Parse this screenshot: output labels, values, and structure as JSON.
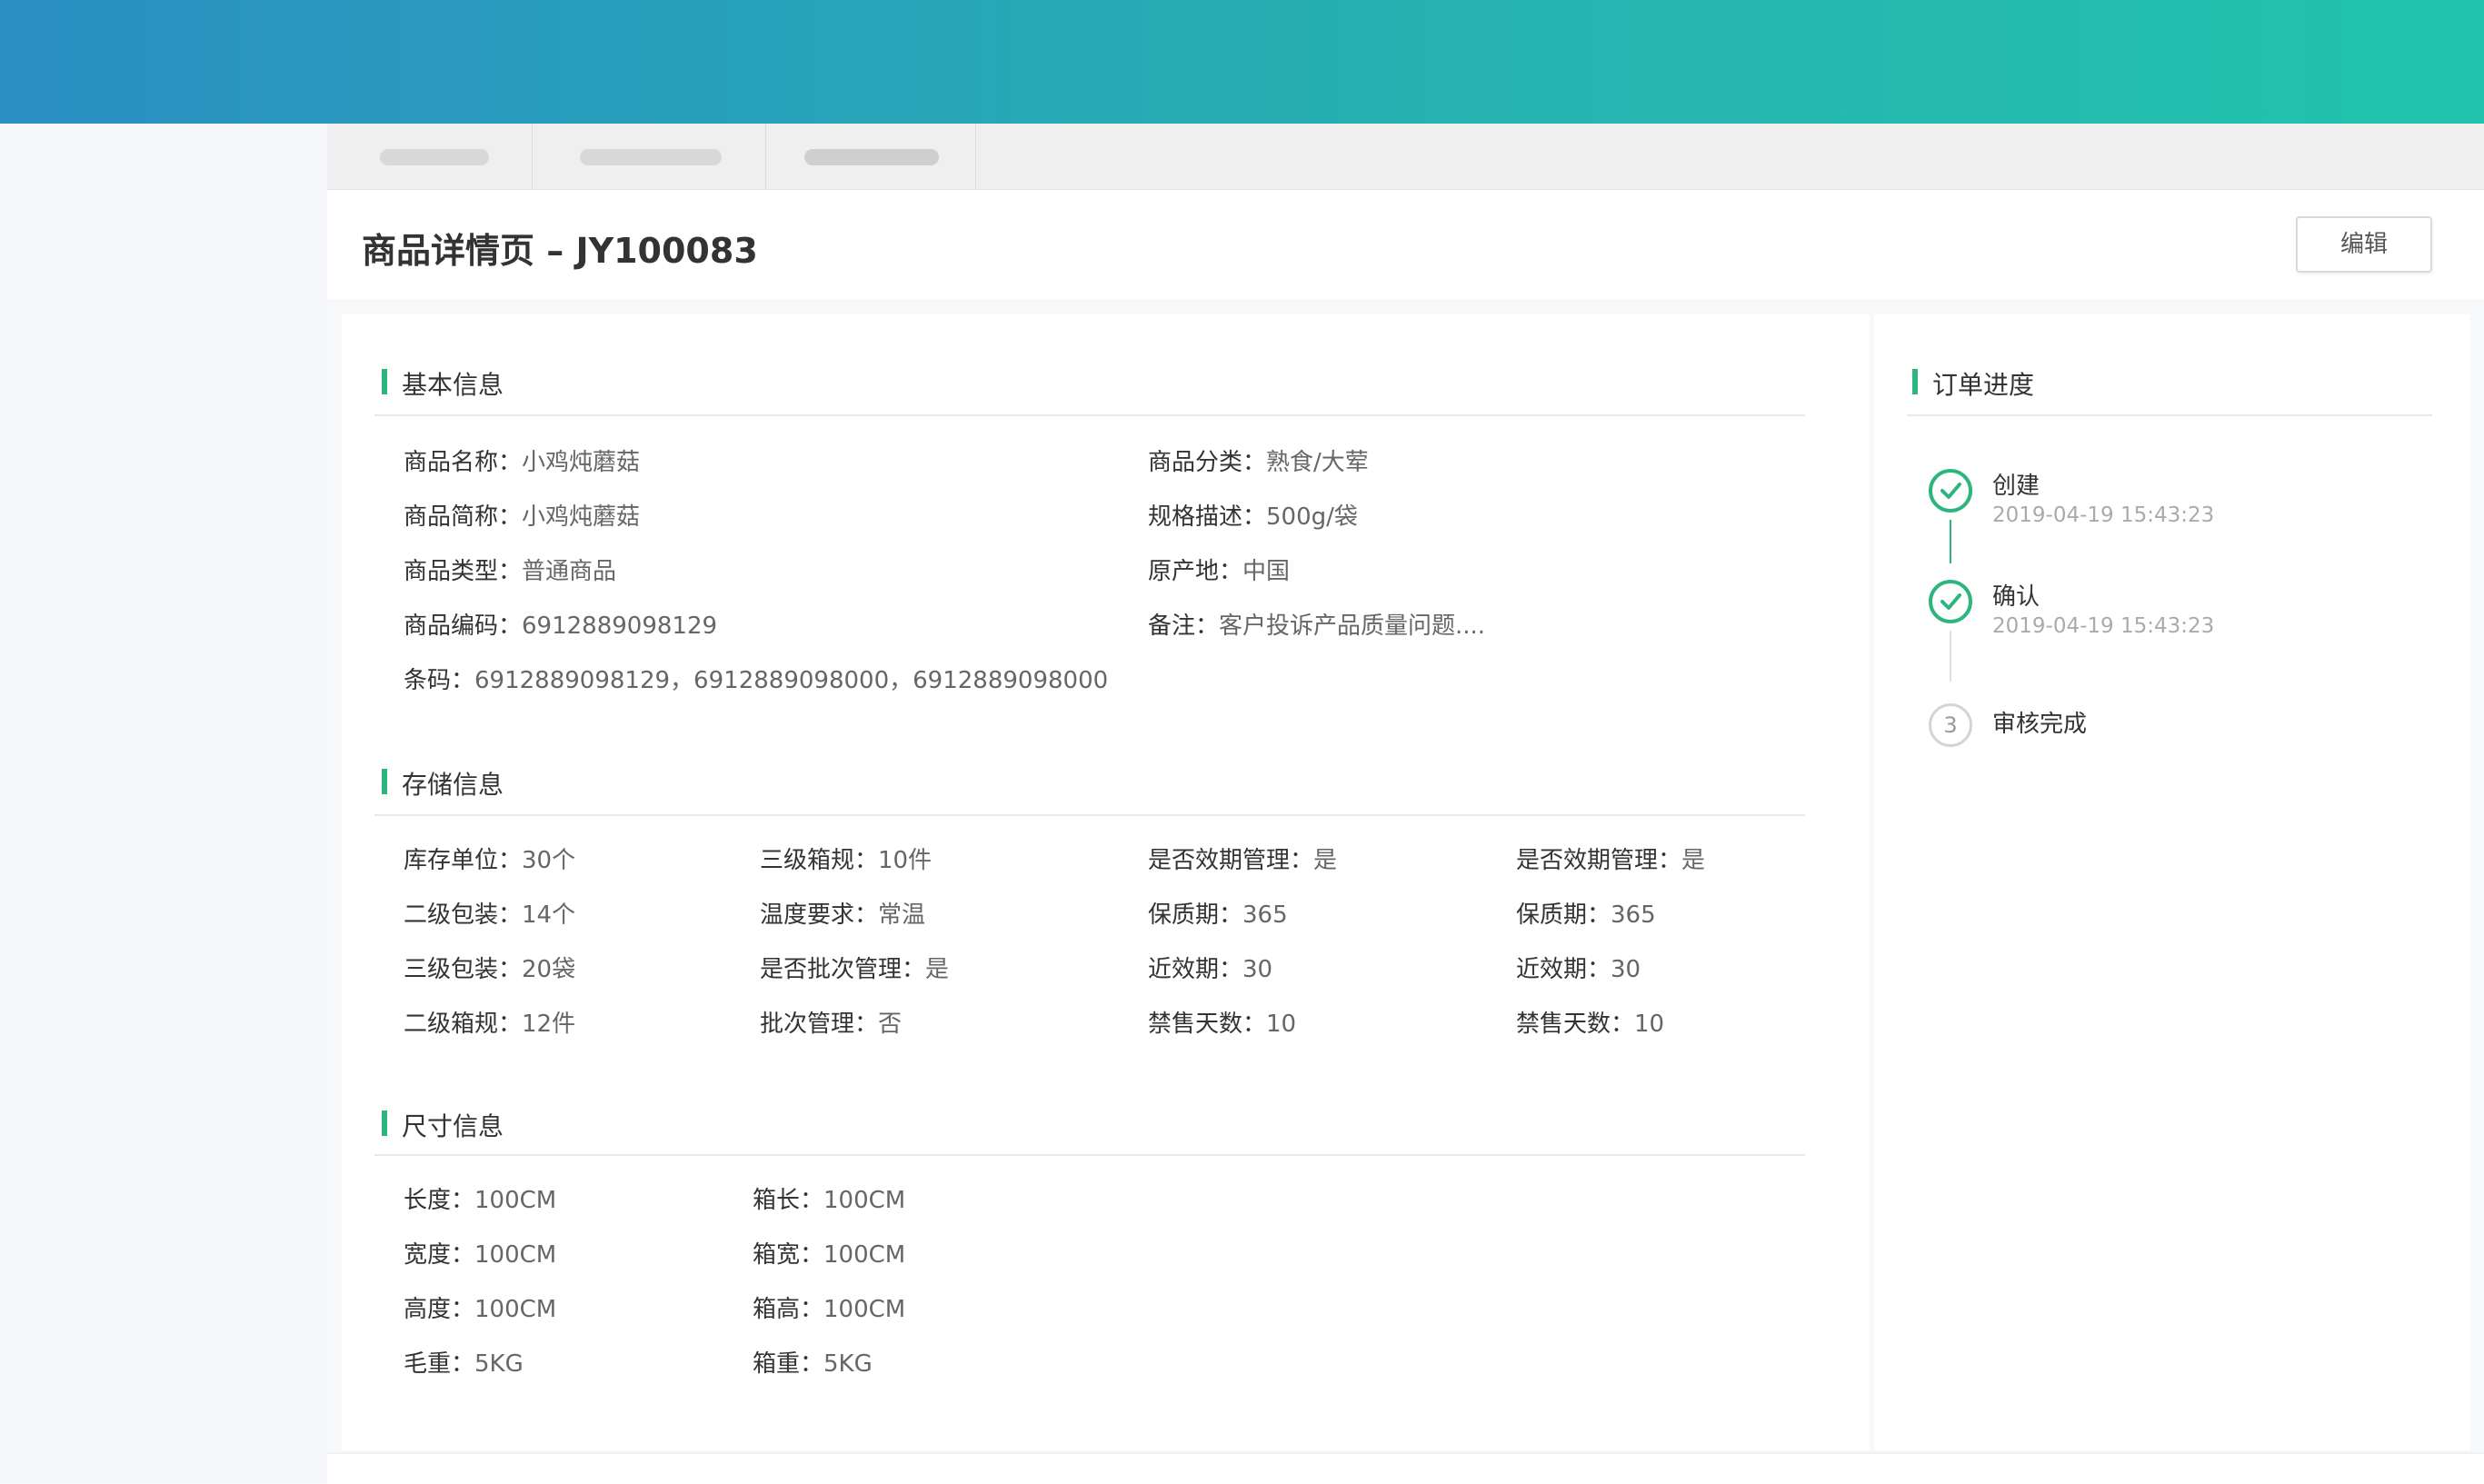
{
  "page": {
    "title": "商品详情页 – JY100083",
    "edit_label": "编辑"
  },
  "colors": {
    "accent": "#2cb67d",
    "header_start": "#2a8fc4",
    "header_end": "#22c3ac"
  },
  "basic": {
    "title": "基本信息",
    "fields": [
      {
        "k": "商品名称：",
        "v": "小鸡炖蘑菇"
      },
      {
        "k": "商品分类：",
        "v": "熟食/大荤"
      },
      {
        "k": "商品简称：",
        "v": "小鸡炖蘑菇"
      },
      {
        "k": "规格描述：",
        "v": "500g/袋"
      },
      {
        "k": "商品类型：",
        "v": "普通商品"
      },
      {
        "k": "原产地：",
        "v": "中国"
      },
      {
        "k": "商品编码：",
        "v": "6912889098129"
      },
      {
        "k": "备注：",
        "v": "客户投诉产品质量问题...."
      },
      {
        "k": "条码：",
        "v": "6912889098129，6912889098000，6912889098000"
      }
    ]
  },
  "storage": {
    "title": "存储信息",
    "fields": [
      {
        "k": "库存单位：",
        "v": "30个"
      },
      {
        "k": "三级箱规：",
        "v": "10件"
      },
      {
        "k": "是否效期管理：",
        "v": "是"
      },
      {
        "k": "是否效期管理：",
        "v": "是"
      },
      {
        "k": "二级包装：",
        "v": "14个"
      },
      {
        "k": "温度要求：",
        "v": "常温"
      },
      {
        "k": "保质期：",
        "v": "365"
      },
      {
        "k": "保质期：",
        "v": "365"
      },
      {
        "k": "三级包装：",
        "v": "20袋"
      },
      {
        "k": "是否批次管理：",
        "v": "是"
      },
      {
        "k": "近效期：",
        "v": "30"
      },
      {
        "k": "近效期：",
        "v": "30"
      },
      {
        "k": "二级箱规：",
        "v": "12件"
      },
      {
        "k": "批次管理：",
        "v": "否"
      },
      {
        "k": "禁售天数：",
        "v": "10"
      },
      {
        "k": "禁售天数：",
        "v": "10"
      }
    ]
  },
  "size": {
    "title": "尺寸信息",
    "fields": [
      {
        "k": "长度：",
        "v": "100CM"
      },
      {
        "k": "箱长：",
        "v": "100CM"
      },
      {
        "k": "宽度：",
        "v": "100CM"
      },
      {
        "k": "箱宽：",
        "v": "100CM"
      },
      {
        "k": "高度：",
        "v": "100CM"
      },
      {
        "k": "箱高：",
        "v": "100CM"
      },
      {
        "k": "毛重：",
        "v": "5KG"
      },
      {
        "k": "箱重：",
        "v": "5KG"
      }
    ]
  },
  "progress": {
    "title": "订单进度",
    "steps": [
      {
        "title": "创建",
        "time": "2019-04-19 15:43:23",
        "status": "done",
        "icon": "check-circle-icon"
      },
      {
        "title": "确认",
        "time": "2019-04-19 15:43:23",
        "status": "done",
        "icon": "check-circle-icon"
      },
      {
        "title": "审核完成",
        "number": "3",
        "status": "todo"
      }
    ]
  }
}
